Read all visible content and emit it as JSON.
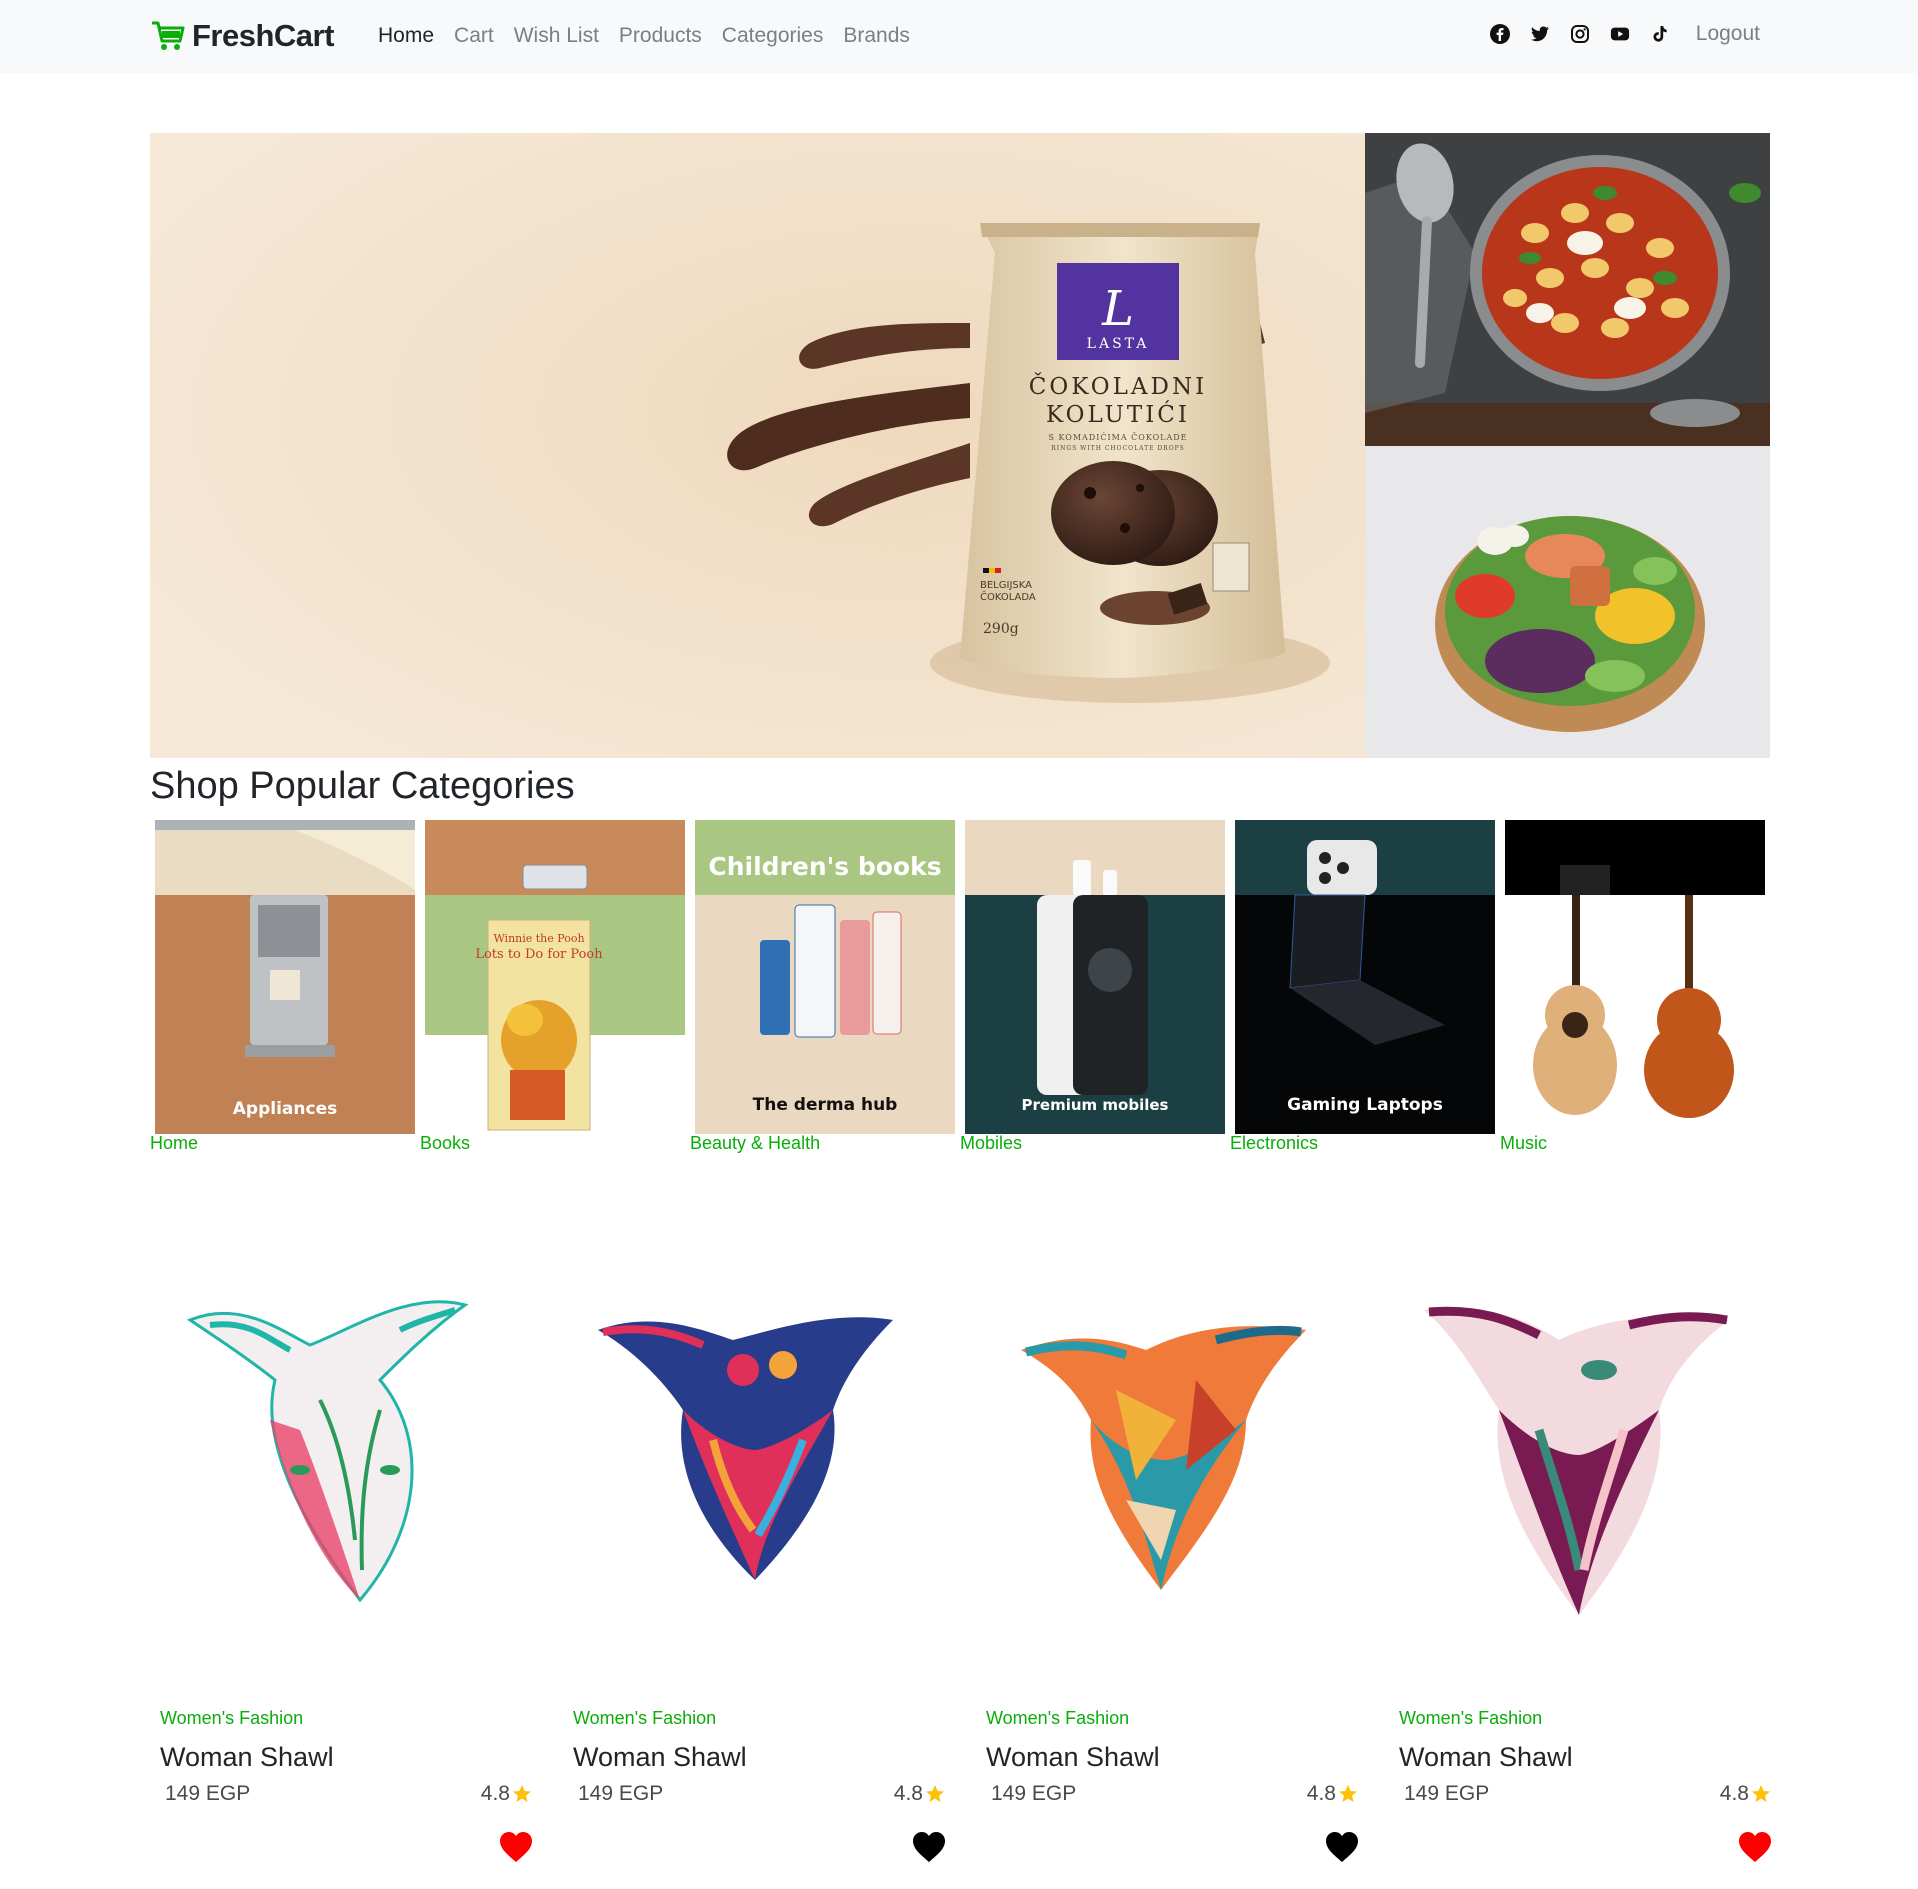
{
  "brand": {
    "name": "FreshCart"
  },
  "nav": {
    "links": [
      "Home",
      "Cart",
      "Wish List",
      "Products",
      "Categories",
      "Brands"
    ],
    "logout": "Logout",
    "social_icons": [
      "facebook-icon",
      "twitter-icon",
      "instagram-icon",
      "youtube-icon",
      "tiktok-icon"
    ]
  },
  "hero": {
    "product_brand": "LASTA",
    "product_name_line1": "ČOKOLADNI",
    "product_name_line2": "KOLUTIĆI",
    "product_sub_line1": "S KOMADIĆIMA ČOKOLADE",
    "product_sub_line2": "RINGS WITH CHOCOLATE DROPS",
    "product_origin_line1": "BELGIJSKA",
    "product_origin_line2": "ČOKOLADA",
    "product_weight": "290g"
  },
  "section_title": "Shop Popular Categories",
  "categories": [
    {
      "name": "Home",
      "caption": "Appliances"
    },
    {
      "name": "Books",
      "caption": ""
    },
    {
      "name": "Beauty & Health",
      "caption": "The derma hub",
      "banner": "Children's books",
      "book_title_1": "Winnie the Pooh",
      "book_title_2": "Lots to Do for Pooh"
    },
    {
      "name": "Mobiles",
      "caption": "Premium mobiles"
    },
    {
      "name": "Electronics",
      "caption": "Gaming Laptops"
    },
    {
      "name": "Music",
      "caption": ""
    }
  ],
  "products": [
    {
      "category": "Women's Fashion",
      "title": "Woman Shawl",
      "price": "149 EGP",
      "rating": "4.8",
      "wishlisted": true
    },
    {
      "category": "Women's Fashion",
      "title": "Woman Shawl",
      "price": "149 EGP",
      "rating": "4.8",
      "wishlisted": false
    },
    {
      "category": "Women's Fashion",
      "title": "Woman Shawl",
      "price": "149 EGP",
      "rating": "4.8",
      "wishlisted": false
    },
    {
      "category": "Women's Fashion",
      "title": "Woman Shawl",
      "price": "149 EGP",
      "rating": "4.8",
      "wishlisted": true
    }
  ],
  "colors": {
    "accent": "#0aad0a",
    "star": "#ffc107",
    "heart_on": "#ff0000",
    "heart_off": "#000000",
    "navbar_bg": "#f8f9fa"
  }
}
